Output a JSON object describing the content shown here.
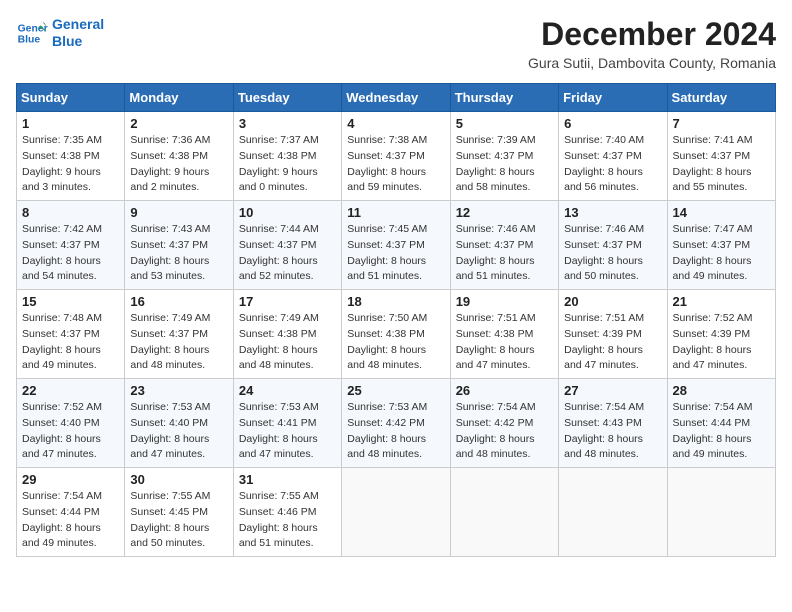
{
  "header": {
    "logo_line1": "General",
    "logo_line2": "Blue",
    "title": "December 2024",
    "subtitle": "Gura Sutii, Dambovita County, Romania"
  },
  "weekdays": [
    "Sunday",
    "Monday",
    "Tuesday",
    "Wednesday",
    "Thursday",
    "Friday",
    "Saturday"
  ],
  "weeks": [
    [
      {
        "day": "1",
        "sunrise": "Sunrise: 7:35 AM",
        "sunset": "Sunset: 4:38 PM",
        "daylight": "Daylight: 9 hours and 3 minutes."
      },
      {
        "day": "2",
        "sunrise": "Sunrise: 7:36 AM",
        "sunset": "Sunset: 4:38 PM",
        "daylight": "Daylight: 9 hours and 2 minutes."
      },
      {
        "day": "3",
        "sunrise": "Sunrise: 7:37 AM",
        "sunset": "Sunset: 4:38 PM",
        "daylight": "Daylight: 9 hours and 0 minutes."
      },
      {
        "day": "4",
        "sunrise": "Sunrise: 7:38 AM",
        "sunset": "Sunset: 4:37 PM",
        "daylight": "Daylight: 8 hours and 59 minutes."
      },
      {
        "day": "5",
        "sunrise": "Sunrise: 7:39 AM",
        "sunset": "Sunset: 4:37 PM",
        "daylight": "Daylight: 8 hours and 58 minutes."
      },
      {
        "day": "6",
        "sunrise": "Sunrise: 7:40 AM",
        "sunset": "Sunset: 4:37 PM",
        "daylight": "Daylight: 8 hours and 56 minutes."
      },
      {
        "day": "7",
        "sunrise": "Sunrise: 7:41 AM",
        "sunset": "Sunset: 4:37 PM",
        "daylight": "Daylight: 8 hours and 55 minutes."
      }
    ],
    [
      {
        "day": "8",
        "sunrise": "Sunrise: 7:42 AM",
        "sunset": "Sunset: 4:37 PM",
        "daylight": "Daylight: 8 hours and 54 minutes."
      },
      {
        "day": "9",
        "sunrise": "Sunrise: 7:43 AM",
        "sunset": "Sunset: 4:37 PM",
        "daylight": "Daylight: 8 hours and 53 minutes."
      },
      {
        "day": "10",
        "sunrise": "Sunrise: 7:44 AM",
        "sunset": "Sunset: 4:37 PM",
        "daylight": "Daylight: 8 hours and 52 minutes."
      },
      {
        "day": "11",
        "sunrise": "Sunrise: 7:45 AM",
        "sunset": "Sunset: 4:37 PM",
        "daylight": "Daylight: 8 hours and 51 minutes."
      },
      {
        "day": "12",
        "sunrise": "Sunrise: 7:46 AM",
        "sunset": "Sunset: 4:37 PM",
        "daylight": "Daylight: 8 hours and 51 minutes."
      },
      {
        "day": "13",
        "sunrise": "Sunrise: 7:46 AM",
        "sunset": "Sunset: 4:37 PM",
        "daylight": "Daylight: 8 hours and 50 minutes."
      },
      {
        "day": "14",
        "sunrise": "Sunrise: 7:47 AM",
        "sunset": "Sunset: 4:37 PM",
        "daylight": "Daylight: 8 hours and 49 minutes."
      }
    ],
    [
      {
        "day": "15",
        "sunrise": "Sunrise: 7:48 AM",
        "sunset": "Sunset: 4:37 PM",
        "daylight": "Daylight: 8 hours and 49 minutes."
      },
      {
        "day": "16",
        "sunrise": "Sunrise: 7:49 AM",
        "sunset": "Sunset: 4:37 PM",
        "daylight": "Daylight: 8 hours and 48 minutes."
      },
      {
        "day": "17",
        "sunrise": "Sunrise: 7:49 AM",
        "sunset": "Sunset: 4:38 PM",
        "daylight": "Daylight: 8 hours and 48 minutes."
      },
      {
        "day": "18",
        "sunrise": "Sunrise: 7:50 AM",
        "sunset": "Sunset: 4:38 PM",
        "daylight": "Daylight: 8 hours and 48 minutes."
      },
      {
        "day": "19",
        "sunrise": "Sunrise: 7:51 AM",
        "sunset": "Sunset: 4:38 PM",
        "daylight": "Daylight: 8 hours and 47 minutes."
      },
      {
        "day": "20",
        "sunrise": "Sunrise: 7:51 AM",
        "sunset": "Sunset: 4:39 PM",
        "daylight": "Daylight: 8 hours and 47 minutes."
      },
      {
        "day": "21",
        "sunrise": "Sunrise: 7:52 AM",
        "sunset": "Sunset: 4:39 PM",
        "daylight": "Daylight: 8 hours and 47 minutes."
      }
    ],
    [
      {
        "day": "22",
        "sunrise": "Sunrise: 7:52 AM",
        "sunset": "Sunset: 4:40 PM",
        "daylight": "Daylight: 8 hours and 47 minutes."
      },
      {
        "day": "23",
        "sunrise": "Sunrise: 7:53 AM",
        "sunset": "Sunset: 4:40 PM",
        "daylight": "Daylight: 8 hours and 47 minutes."
      },
      {
        "day": "24",
        "sunrise": "Sunrise: 7:53 AM",
        "sunset": "Sunset: 4:41 PM",
        "daylight": "Daylight: 8 hours and 47 minutes."
      },
      {
        "day": "25",
        "sunrise": "Sunrise: 7:53 AM",
        "sunset": "Sunset: 4:42 PM",
        "daylight": "Daylight: 8 hours and 48 minutes."
      },
      {
        "day": "26",
        "sunrise": "Sunrise: 7:54 AM",
        "sunset": "Sunset: 4:42 PM",
        "daylight": "Daylight: 8 hours and 48 minutes."
      },
      {
        "day": "27",
        "sunrise": "Sunrise: 7:54 AM",
        "sunset": "Sunset: 4:43 PM",
        "daylight": "Daylight: 8 hours and 48 minutes."
      },
      {
        "day": "28",
        "sunrise": "Sunrise: 7:54 AM",
        "sunset": "Sunset: 4:44 PM",
        "daylight": "Daylight: 8 hours and 49 minutes."
      }
    ],
    [
      {
        "day": "29",
        "sunrise": "Sunrise: 7:54 AM",
        "sunset": "Sunset: 4:44 PM",
        "daylight": "Daylight: 8 hours and 49 minutes."
      },
      {
        "day": "30",
        "sunrise": "Sunrise: 7:55 AM",
        "sunset": "Sunset: 4:45 PM",
        "daylight": "Daylight: 8 hours and 50 minutes."
      },
      {
        "day": "31",
        "sunrise": "Sunrise: 7:55 AM",
        "sunset": "Sunset: 4:46 PM",
        "daylight": "Daylight: 8 hours and 51 minutes."
      },
      null,
      null,
      null,
      null
    ]
  ]
}
